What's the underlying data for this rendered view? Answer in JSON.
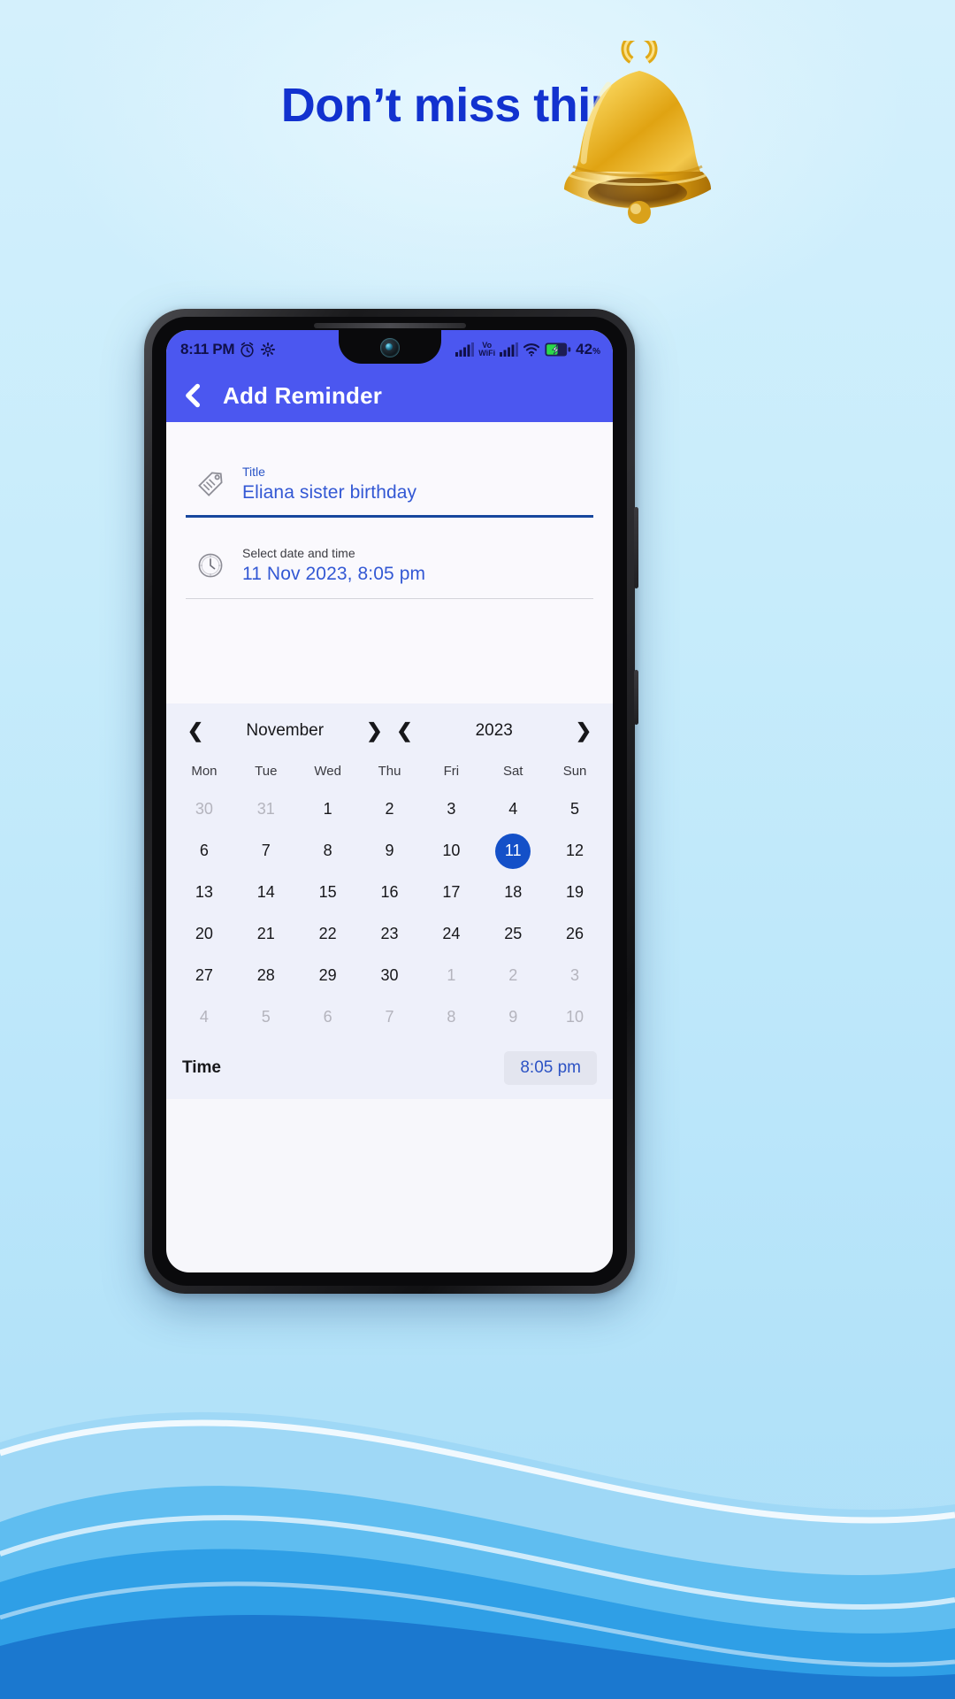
{
  "promo": {
    "headline": "Don’t miss things",
    "headline_color": "#1232cf",
    "bell_icon": "bell-emoji",
    "background_color": "#c7ecfb"
  },
  "phone": {
    "statusbar": {
      "time": "8:11 PM",
      "alarm_icon": "alarm-icon",
      "gear_icon": "gear-icon",
      "signal_icon": "signal-bars-icon",
      "vowifi_line1": "Vo",
      "vowifi_line2": "WiFi",
      "signal2_icon": "signal-bars-icon",
      "wifi_icon": "wifi-icon",
      "battery_icon": "battery-charging-icon",
      "battery_level": "42",
      "battery_unit": "%"
    },
    "appbar": {
      "back_icon": "back-chevron-icon",
      "title": "Add Reminder",
      "bar_color": "#4b57f0"
    },
    "form": {
      "title_field": {
        "icon": "tag-icon",
        "label": "Title",
        "value": "Eliana sister birthday"
      },
      "datetime_field": {
        "icon": "clock-icon",
        "label": "Select date and time",
        "value": "11 Nov 2023, 8:05 pm"
      }
    },
    "calendar": {
      "prev_month_icon": "chevron-left-icon",
      "month": "November",
      "next_month_icon": "chevron-right-icon",
      "prev_year_icon": "chevron-left-icon",
      "year": "2023",
      "next_year_icon": "chevron-right-icon",
      "weekdays": [
        "Mon",
        "Tue",
        "Wed",
        "Thu",
        "Fri",
        "Sat",
        "Sun"
      ],
      "selected_day": 11,
      "accent_color": "#1450c8",
      "weeks": [
        [
          {
            "d": "30",
            "muted": true
          },
          {
            "d": "31",
            "muted": true
          },
          {
            "d": "1"
          },
          {
            "d": "2"
          },
          {
            "d": "3"
          },
          {
            "d": "4"
          },
          {
            "d": "5"
          }
        ],
        [
          {
            "d": "6"
          },
          {
            "d": "7"
          },
          {
            "d": "8"
          },
          {
            "d": "9"
          },
          {
            "d": "10"
          },
          {
            "d": "11",
            "selected": true
          },
          {
            "d": "12"
          }
        ],
        [
          {
            "d": "13"
          },
          {
            "d": "14"
          },
          {
            "d": "15"
          },
          {
            "d": "16"
          },
          {
            "d": "17"
          },
          {
            "d": "18"
          },
          {
            "d": "19"
          }
        ],
        [
          {
            "d": "20"
          },
          {
            "d": "21"
          },
          {
            "d": "22"
          },
          {
            "d": "23"
          },
          {
            "d": "24"
          },
          {
            "d": "25"
          },
          {
            "d": "26"
          }
        ],
        [
          {
            "d": "27"
          },
          {
            "d": "28"
          },
          {
            "d": "29"
          },
          {
            "d": "30"
          },
          {
            "d": "1",
            "muted": true
          },
          {
            "d": "2",
            "muted": true
          },
          {
            "d": "3",
            "muted": true
          }
        ],
        [
          {
            "d": "4",
            "muted": true
          },
          {
            "d": "5",
            "muted": true
          },
          {
            "d": "6",
            "muted": true
          },
          {
            "d": "7",
            "muted": true
          },
          {
            "d": "8",
            "muted": true
          },
          {
            "d": "9",
            "muted": true
          },
          {
            "d": "10",
            "muted": true
          }
        ]
      ],
      "time_label": "Time",
      "time_value": "8:05 pm"
    }
  }
}
